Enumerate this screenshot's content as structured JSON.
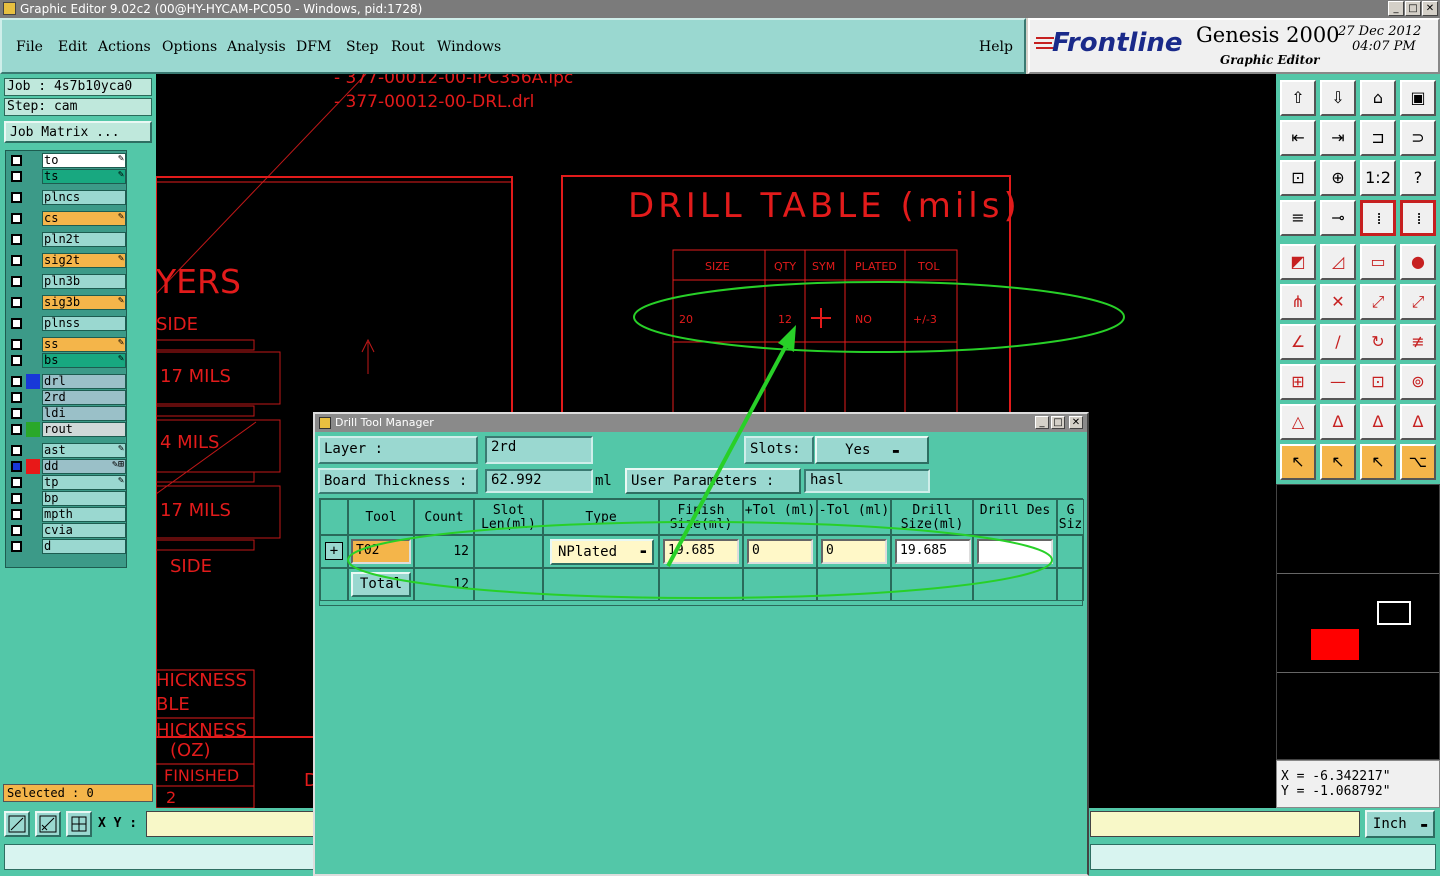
{
  "window_title": "Graphic Editor 9.02c2 (00@HY-HYCAM-PC050 - Windows, pid:1728)",
  "menu": {
    "file": "File",
    "edit": "Edit",
    "actions": "Actions",
    "options": "Options",
    "analysis": "Analysis",
    "dfm": "DFM",
    "step": "Step",
    "rout": "Rout",
    "windows": "Windows",
    "help": "Help"
  },
  "brand": {
    "logo": "Frontline",
    "product": "Genesis 2000",
    "subtitle": "Graphic Editor",
    "date": "27 Dec 2012",
    "time": "04:07 PM"
  },
  "job": {
    "job_line": "Job : 4s7b10yca0",
    "step_line": "Step: cam",
    "matrix_button": "Job Matrix ..."
  },
  "layers": [
    {
      "name": "to",
      "color": "#ffffff",
      "edit": "✎"
    },
    {
      "name": "ts",
      "color": "#18a880",
      "edit": "✎"
    },
    {
      "name": "plncs",
      "color": "#9ad8d0",
      "edit": ""
    },
    {
      "name": "cs",
      "color": "#f4b54a",
      "edit": "✎"
    },
    {
      "name": "pln2t",
      "color": "#9ad8d0",
      "edit": ""
    },
    {
      "name": "sig2t",
      "color": "#f4b54a",
      "edit": "✎"
    },
    {
      "name": "pln3b",
      "color": "#9ad8d0",
      "edit": ""
    },
    {
      "name": "sig3b",
      "color": "#f4b54a",
      "edit": "✎"
    },
    {
      "name": "plnss",
      "color": "#9ad8d0",
      "edit": ""
    },
    {
      "name": "ss",
      "color": "#f4b54a",
      "edit": "✎"
    },
    {
      "name": "bs",
      "color": "#18a880",
      "edit": "✎"
    },
    {
      "name": "drl",
      "color": "#9ac0c8",
      "edit": ""
    },
    {
      "name": "2rd",
      "color": "#9ac0c8",
      "edit": ""
    },
    {
      "name": "ldi",
      "color": "#9ac0c8",
      "edit": ""
    },
    {
      "name": "rout",
      "color": "#d0d8d8",
      "edit": ""
    },
    {
      "name": "ast",
      "color": "#9ad8d0",
      "edit": "✎"
    },
    {
      "name": "dd",
      "color": "#9ac0c8",
      "edit": "✎⊞"
    },
    {
      "name": "tp",
      "color": "#9ad8d0",
      "edit": "✎"
    },
    {
      "name": "bp",
      "color": "#9ad8d0",
      "edit": ""
    },
    {
      "name": "mpth",
      "color": "#9ad8d0",
      "edit": ""
    },
    {
      "name": "cvia",
      "color": "#9ad8d0",
      "edit": ""
    },
    {
      "name": "d",
      "color": "#9ad8d0",
      "edit": ""
    }
  ],
  "selected": "Selected : 0",
  "canvas": {
    "files": [
      "- 377-00012-00-IPC356A.ipc",
      "- 377-00012-00-DRL.drl"
    ],
    "drill_table_title": "DRILL TABLE (mils)",
    "columns": [
      "SIZE",
      "QTY",
      "SYM",
      "PLATED",
      "TOL"
    ],
    "row": [
      "20",
      "12",
      "+",
      "NO",
      "+/-3"
    ],
    "left_texts": {
      "layers": "YERS",
      "side1": "SIDE",
      "mils1": "17 MILS",
      "mils2": "4 MILS",
      "mils3": "17 MILS",
      "side2": "SIDE",
      "thickness": "HICKNESS",
      "able": "BLE",
      "thickness2": "HICKNESS",
      "oz": "(OZ)",
      "finished": "FINISHED",
      "num": "2",
      "d": "D"
    }
  },
  "coords": {
    "x": "X = -6.342217\"",
    "y": "Y = -1.068792\""
  },
  "xy_label": "X Y :",
  "units": "Inch",
  "dialog": {
    "title": "Drill Tool Manager",
    "layer_label": "Layer :",
    "layer_value": "2rd",
    "slots_label": "Slots:",
    "slots_value": "Yes",
    "thickness_label": "Board Thickness :",
    "thickness_value": "62.992",
    "thickness_unit": "ml",
    "user_params_label": "User Parameters :",
    "user_params_value": "hasl",
    "headers": [
      "Tool",
      "Count",
      "Slot Len(ml)",
      "Type",
      "Finish Size(ml)",
      "+Tol (ml)",
      "-Tol (ml)",
      "Drill Size(ml)",
      "Drill Des",
      "G Siz"
    ],
    "row": {
      "tool": "T02",
      "count": "12",
      "type": "NPlated",
      "finish": "19.685",
      "ptol": "0",
      "mtol": "0",
      "drill": "19.685",
      "des": ""
    },
    "total_label": "Total",
    "total_count": "12"
  }
}
